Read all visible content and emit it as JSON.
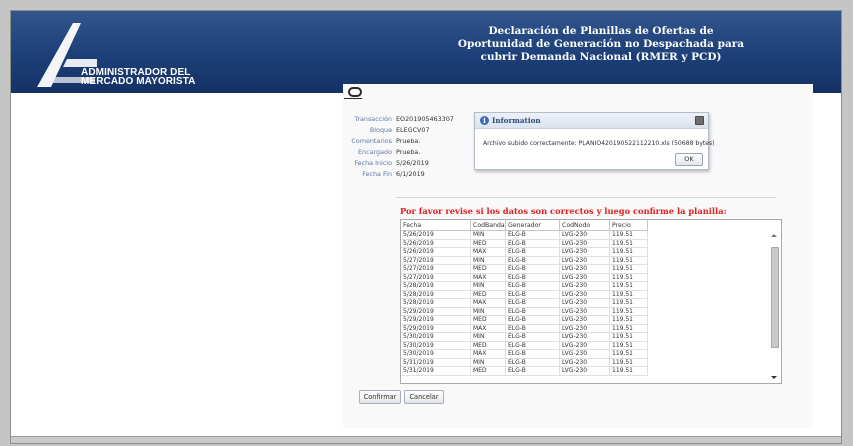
{
  "header": {
    "logo_line1": "ADMINISTRADOR DEL",
    "logo_line2": "MERCADO MAYORISTA",
    "title_line1": "Declaración de Planillas de Ofertas de",
    "title_line2": "Oportunidad de Generación no Despachada para",
    "title_line3": "cubrir Demanda Nacional (RMER y PCD)"
  },
  "form": {
    "fields": [
      {
        "label": "Transacción",
        "value": "EO201905463307"
      },
      {
        "label": "Bloque",
        "value": "ELEGCV07"
      },
      {
        "label": "Comentarios",
        "value": "Prueba."
      },
      {
        "label": "Encargado",
        "value": "Prueba."
      },
      {
        "label": "Fecha Inicio",
        "value": "5/26/2019"
      },
      {
        "label": "Fecha Fin",
        "value": "6/1/2019"
      }
    ]
  },
  "dialog": {
    "title": "Information",
    "message": "Archivo subido correctamente: PLANIO420190522112210.xls (50688 bytes)",
    "ok_label": "OK"
  },
  "confirm_message": "Por favor revise si los datos son correctos y luego confirme la planilla:",
  "table": {
    "columns": [
      "Fecha",
      "CodBanda",
      "Generador",
      "CodNodo",
      "Precio"
    ],
    "rows": [
      [
        "5/26/2019",
        "MIN",
        "ELG-B",
        "LVG-230",
        "119.51"
      ],
      [
        "5/26/2019",
        "MED",
        "ELG-B",
        "LVG-230",
        "119.51"
      ],
      [
        "5/26/2019",
        "MAX",
        "ELG-B",
        "LVG-230",
        "119.51"
      ],
      [
        "5/27/2019",
        "MIN",
        "ELG-B",
        "LVG-230",
        "119.51"
      ],
      [
        "5/27/2019",
        "MED",
        "ELG-B",
        "LVG-230",
        "119.51"
      ],
      [
        "5/27/2019",
        "MAX",
        "ELG-B",
        "LVG-230",
        "119.51"
      ],
      [
        "5/28/2019",
        "MIN",
        "ELG-B",
        "LVG-230",
        "119.51"
      ],
      [
        "5/28/2019",
        "MED",
        "ELG-B",
        "LVG-230",
        "119.51"
      ],
      [
        "5/28/2019",
        "MAX",
        "ELG-B",
        "LVG-230",
        "119.51"
      ],
      [
        "5/29/2019",
        "MIN",
        "ELG-B",
        "LVG-230",
        "119.51"
      ],
      [
        "5/29/2019",
        "MED",
        "ELG-B",
        "LVG-230",
        "119.51"
      ],
      [
        "5/29/2019",
        "MAX",
        "ELG-B",
        "LVG-230",
        "119.51"
      ],
      [
        "5/30/2019",
        "MIN",
        "ELG-B",
        "LVG-230",
        "119.51"
      ],
      [
        "5/30/2019",
        "MED",
        "ELG-B",
        "LVG-230",
        "119.51"
      ],
      [
        "5/30/2019",
        "MAX",
        "ELG-B",
        "LVG-230",
        "119.51"
      ],
      [
        "5/31/2019",
        "MIN",
        "ELG-B",
        "LVG-230",
        "119.51"
      ],
      [
        "5/31/2019",
        "MED",
        "ELG-B",
        "LVG-230",
        "119.51"
      ]
    ]
  },
  "buttons": {
    "confirm": "Confirmar",
    "cancel": "Cancelar"
  },
  "icons": {
    "logo": "amm-logo-icon",
    "info": "info-icon",
    "close": "close-icon",
    "oracle": "oracle-logo-icon"
  },
  "colors": {
    "header_bg": "#1d3f77",
    "label_blue": "#5d79a8",
    "alert_red": "#e02020"
  }
}
